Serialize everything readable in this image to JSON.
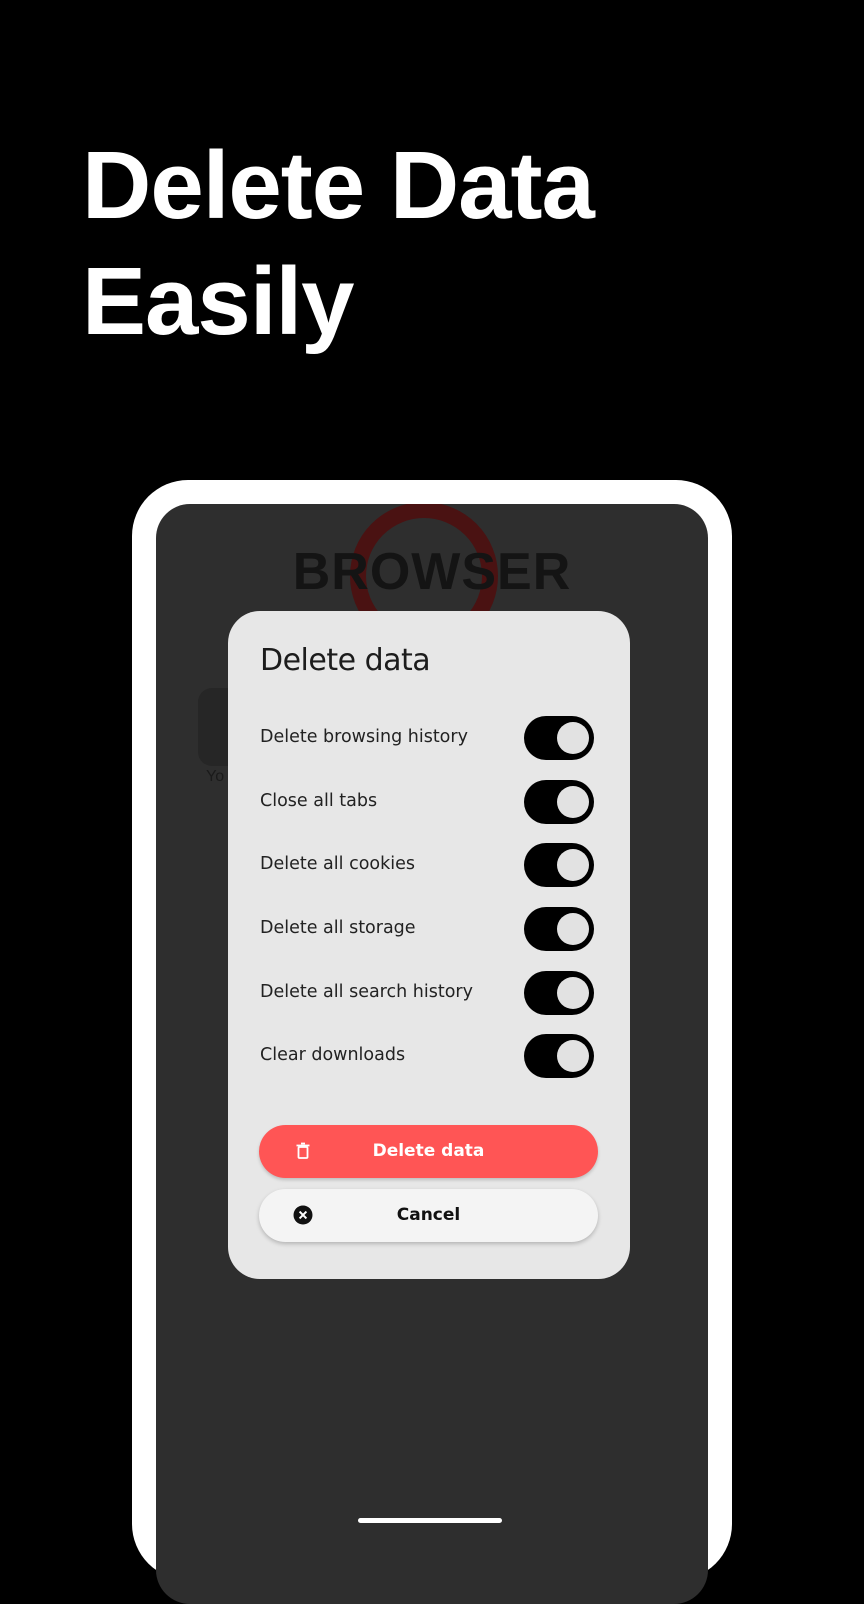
{
  "headline": {
    "line1": "Delete Data",
    "line2": "Easily"
  },
  "background_app": {
    "logo_text": "BROWSER",
    "shortcut_label": "Yo"
  },
  "dialog": {
    "title": "Delete data",
    "options": [
      {
        "label": "Delete browsing history",
        "enabled": true
      },
      {
        "label": "Close all tabs",
        "enabled": true
      },
      {
        "label": "Delete all cookies",
        "enabled": true
      },
      {
        "label": "Delete all storage",
        "enabled": true
      },
      {
        "label": "Delete all search history",
        "enabled": true
      },
      {
        "label": "Clear downloads",
        "enabled": true
      }
    ],
    "delete_button": {
      "label": "Delete data",
      "icon": "trash-icon"
    },
    "cancel_button": {
      "label": "Cancel",
      "icon": "close-circle-icon"
    }
  },
  "colors": {
    "page_background": "#000000",
    "dialog_background": "#e7e7e7",
    "accent_delete": "#ff5555",
    "toggle_on": "#000000"
  }
}
